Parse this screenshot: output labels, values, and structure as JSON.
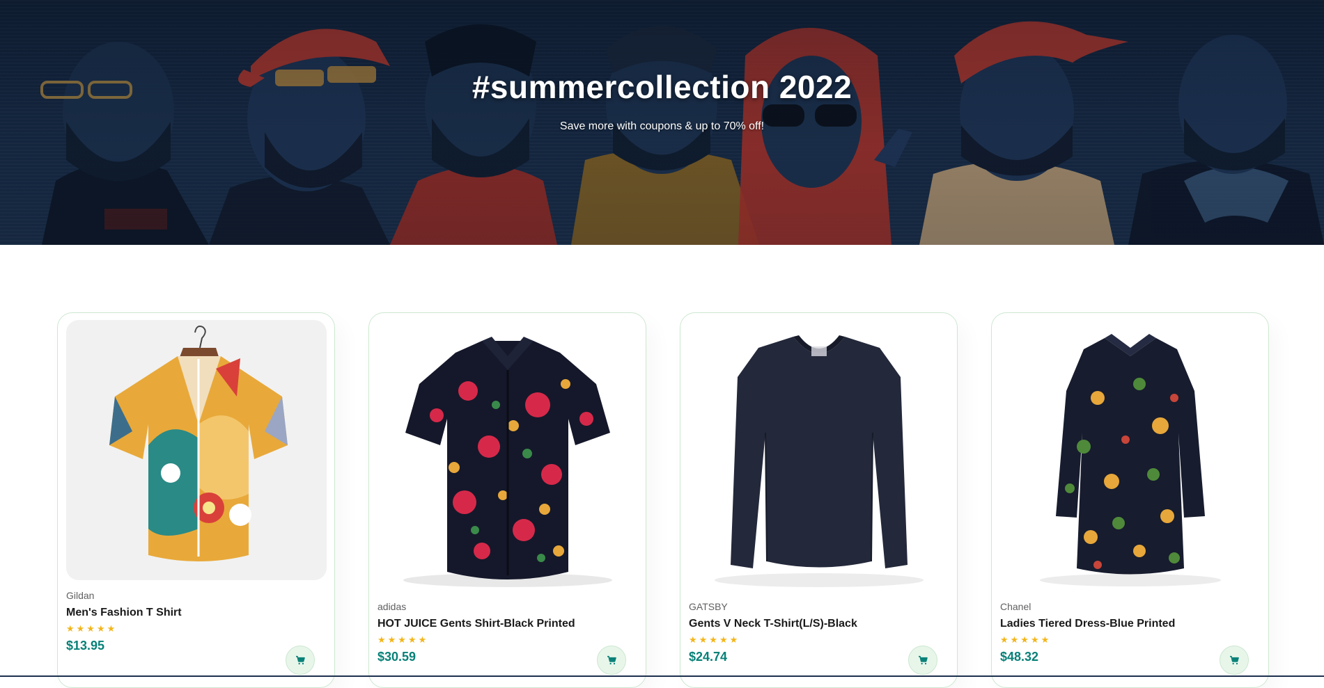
{
  "hero": {
    "title": "#summercollection 2022",
    "subtitle": "Save more with coupons & up to 70% off!"
  },
  "colors": {
    "accent": "#088178",
    "star": "#f3b519",
    "card_border": "#cce7d0",
    "cart_bg": "#e8f6ea",
    "hero_bg": "#13253e"
  },
  "products": [
    {
      "brand": "Gildan",
      "name": "Men's Fashion T Shirt",
      "rating": 5,
      "stars": "★★★★★",
      "price": "$13.95",
      "image": "floral-shirt-on-hanger",
      "cart_icon": "cart-icon"
    },
    {
      "brand": "adidas",
      "name": "HOT JUICE Gents Shirt-Black Printed",
      "rating": 5,
      "stars": "★★★★★",
      "price": "$30.59",
      "image": "black-floral-shirt",
      "cart_icon": "cart-icon"
    },
    {
      "brand": "GATSBY",
      "name": "Gents V Neck T-Shirt(L/S)-Black",
      "rating": 5,
      "stars": "★★★★★",
      "price": "$24.74",
      "image": "navy-long-sleeve-tee",
      "cart_icon": "cart-icon"
    },
    {
      "brand": "Chanel",
      "name": "Ladies Tiered Dress-Blue Printed",
      "rating": 5,
      "stars": "★★★★★",
      "price": "$48.32",
      "image": "navy-floral-dress",
      "cart_icon": "cart-icon"
    }
  ]
}
